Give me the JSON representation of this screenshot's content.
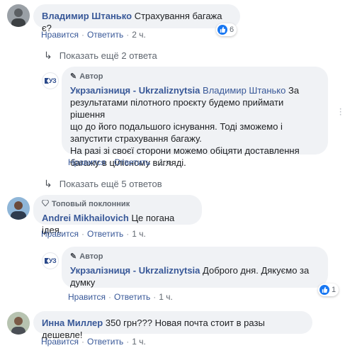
{
  "comments": [
    {
      "name": "Владимир Штанько",
      "text": "Страхування багажа є?",
      "like": "Нравится",
      "reply": "Ответить",
      "time": "2 ч.",
      "reactions": "6"
    }
  ],
  "more1": "Показать ещё 2 ответа",
  "author_label": "Автор",
  "reply1": {
    "page": "Укрзалізниця - Ukrzaliznytsia",
    "mention": "Владимир Штанько",
    "line1": "За",
    "line2": "результатами пілотного проєкту будемо приймати рішення",
    "line3": "що до його подальшого існування. Тоді зможемо і",
    "line4": "запустити страхування багажу.",
    "line5": "На разі зі своєї сторони можемо обіцяти доставлення",
    "line6": "багажу в цілісному вигляді.",
    "like": "Нравится",
    "reply": "Ответить",
    "time": "1 ч."
  },
  "more2": "Показать ещё 5 ответов",
  "comment2": {
    "badge": "Топовый поклонник",
    "name": "Andrei Mikhailovich",
    "text": "Це погана ідея.",
    "like": "Нравится",
    "reply": "Ответить",
    "time": "1 ч."
  },
  "reply2": {
    "page": "Укрзалізниця - Ukrzaliznytsia",
    "line1": "Доброго дня. Дякуємо за",
    "line2": "думку",
    "like": "Нравится",
    "reply": "Ответить",
    "time": "1 ч.",
    "reactions": "1"
  },
  "comment3": {
    "name": "Инна Миллер",
    "text": "350 грн??? Новая почта стоит в разы дешевле!",
    "like": "Нравится",
    "reply": "Ответить",
    "time": "1 ч."
  },
  "page_logo_text": "УЗ",
  "colors": {
    "link": "#385898",
    "bubble": "#f0f2f5",
    "like_blue": "#1877f2"
  }
}
